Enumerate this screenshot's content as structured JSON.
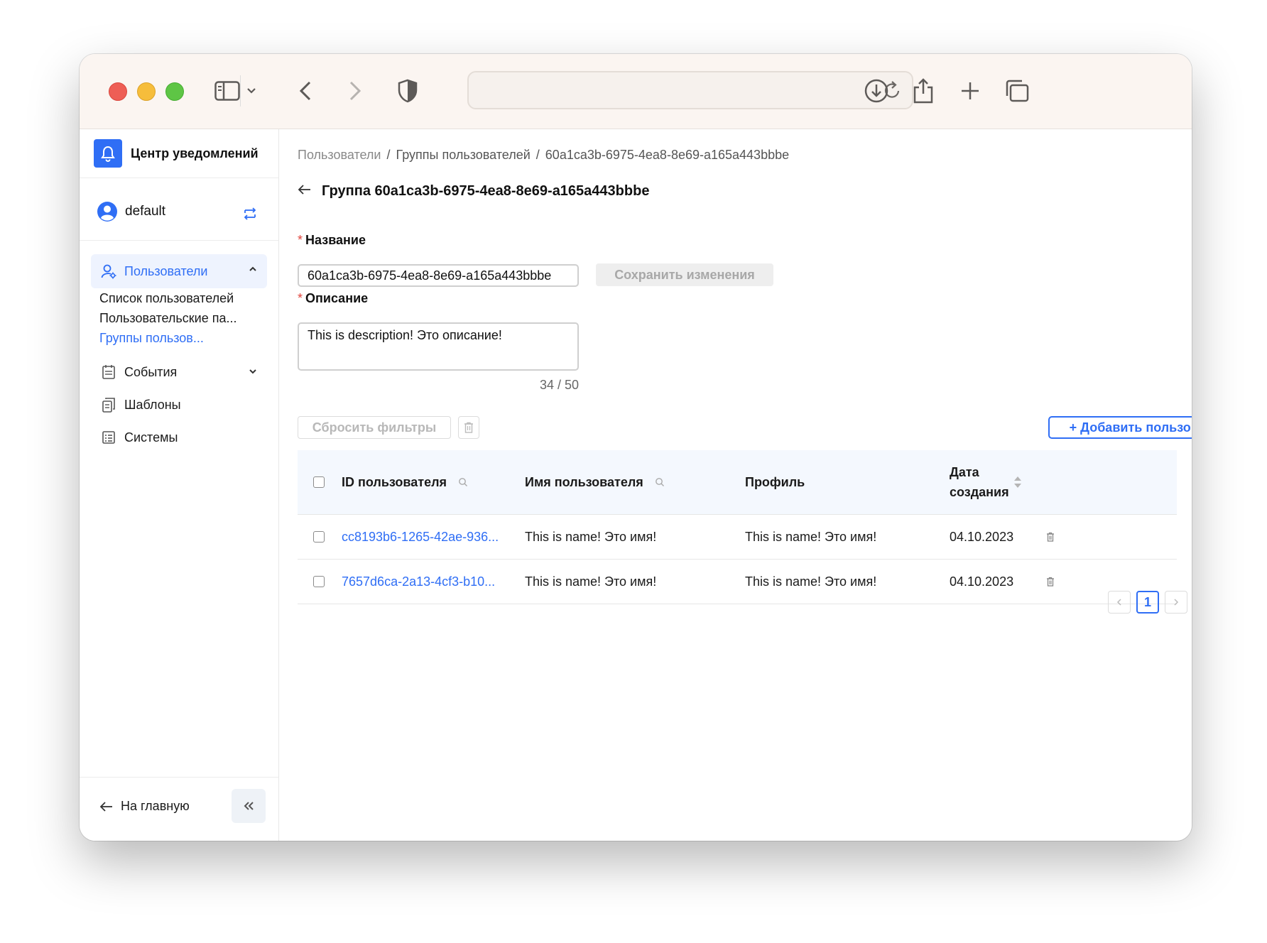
{
  "app": {
    "brand": "Центр уведомлений",
    "accent_color": "#2f6ef5"
  },
  "sidebar": {
    "user_name": "default",
    "sections": [
      {
        "label": "Пользователи",
        "icon": "user-settings-icon",
        "expanded": true,
        "active": true
      },
      {
        "label": "События",
        "icon": "calendar-icon",
        "expanded": false
      },
      {
        "label": "Шаблоны",
        "icon": "copy-icon"
      },
      {
        "label": "Системы",
        "icon": "list-icon"
      }
    ],
    "sub_items": [
      "Список пользователей",
      "Пользовательские па...",
      "Группы пользов..."
    ],
    "home_label": "На главную"
  },
  "breadcrumb": [
    "Пользователи",
    "Группы пользователей",
    "60a1ca3b-6975-4ea8-8e69-a165a443bbbe"
  ],
  "breadcrumb_sep": "/",
  "page": {
    "title": "Группа 60a1ca3b-6975-4ea8-8e69-a165a443bbbe"
  },
  "form": {
    "name_label": "Название",
    "name_value": "60a1ca3b-6975-4ea8-8e69-a165a443bbbe",
    "save_label": "Сохранить изменения",
    "description_label": "Описание",
    "description_value": "This is description! Это описание!",
    "counter": "34 / 50",
    "required_mark": "*"
  },
  "toolbar": {
    "reset_label": "Сбросить фильтры",
    "add_label": "+ Добавить пользователя"
  },
  "table": {
    "columns": [
      "ID пользователя",
      "Имя пользователя",
      "Профиль",
      "Дата",
      "создания"
    ],
    "rows": [
      {
        "id": "cc8193b6-1265-42ae-936...",
        "name": "This is name! Это имя!",
        "profile": "This is name! Это имя!",
        "date": "04.10.2023"
      },
      {
        "id": "7657d6ca-2a13-4cf3-b10...",
        "name": "This is name! Это имя!",
        "profile": "This is name! Это имя!",
        "date": "04.10.2023"
      }
    ]
  },
  "pagination": {
    "current_page": "1"
  }
}
